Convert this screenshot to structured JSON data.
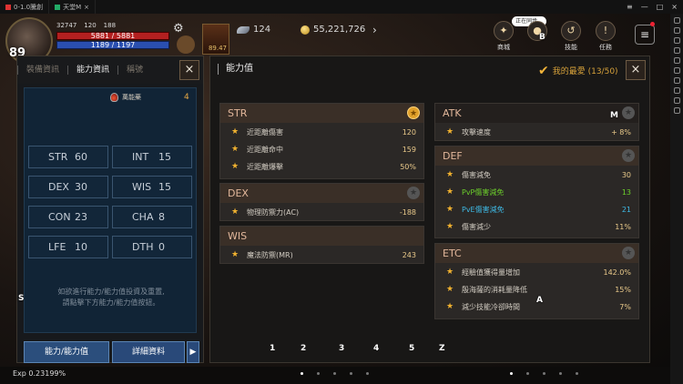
{
  "window": {
    "tab1": "0-1.0騰創",
    "tab2": "天堂M"
  },
  "hud": {
    "level": "89",
    "stat_a": "32747",
    "stat_b": "120",
    "stat_c": "188",
    "hp": "5881 / 5881",
    "mp": "1189 / 1197",
    "slot_count": "89.47",
    "wing_value": "124",
    "gold_value": "55,221,726",
    "recording": "正在同步...",
    "btn_shop": "商城",
    "btn_skill": "技能",
    "btn_quest": "任務",
    "letter_b": "B",
    "letter_m": "M",
    "letter_s": "S",
    "letter_a": "A",
    "exp": "Exp 0.23199%",
    "hotkeys": [
      "1",
      "2",
      "3",
      "4",
      "5",
      "Z"
    ],
    "colors": {
      "hp": "#b32020",
      "mp": "#2a4fb0",
      "accent": "#f1b230"
    }
  },
  "left_panel": {
    "tabs": [
      "裝備資訊",
      "能力資訊",
      "稱號"
    ],
    "active_tab": 1,
    "potion_label": "萬能藥",
    "potion_count": "4",
    "stats": [
      {
        "key": "STR",
        "value": "60"
      },
      {
        "key": "INT",
        "value": "15"
      },
      {
        "key": "DEX",
        "value": "30"
      },
      {
        "key": "WIS",
        "value": "15"
      },
      {
        "key": "CON",
        "value": "23"
      },
      {
        "key": "CHA",
        "value": "8"
      },
      {
        "key": "LFE",
        "value": "10"
      },
      {
        "key": "DTH",
        "value": "0"
      }
    ],
    "hint_line1": "如欲進行能力/能力值投資及重置,",
    "hint_line2": "請點擊下方能力/能力值按鈕。",
    "btn_ability": "能力/能力值",
    "btn_detail": "詳細資料",
    "btn_arrow": "▶"
  },
  "right_panel": {
    "title": "能力值",
    "favorites": "我的最愛 (13/50)",
    "groups": {
      "str": {
        "title": "STR",
        "rows": [
          {
            "name": "近距離傷害",
            "value": "120"
          },
          {
            "name": "近距離命中",
            "value": "159"
          },
          {
            "name": "近距離爆擊",
            "value": "50%"
          }
        ]
      },
      "dex": {
        "title": "DEX",
        "rows": [
          {
            "name": "物理防禦力(AC)",
            "value": "-188"
          }
        ]
      },
      "wis": {
        "title": "WIS",
        "rows": [
          {
            "name": "魔法防禦(MR)",
            "value": "243"
          }
        ]
      },
      "atk": {
        "title": "ATK",
        "rows": [
          {
            "name": "攻擊速度",
            "value": "+ 8%"
          }
        ]
      },
      "def": {
        "title": "DEF",
        "rows": [
          {
            "name": "傷害減免",
            "value": "30"
          },
          {
            "name": "PvP傷害減免",
            "value": "13"
          },
          {
            "name": "PvE傷害減免",
            "value": "21"
          },
          {
            "name": "傷害減少",
            "value": "11%"
          }
        ]
      },
      "etc": {
        "title": "ETC",
        "rows": [
          {
            "name": "經驗值獲得量增加",
            "value": "142.0%"
          },
          {
            "name": "殷海薩的消耗量降低",
            "value": "15%"
          },
          {
            "name": "減少技能冷卻時間",
            "value": "7%"
          }
        ]
      }
    }
  }
}
